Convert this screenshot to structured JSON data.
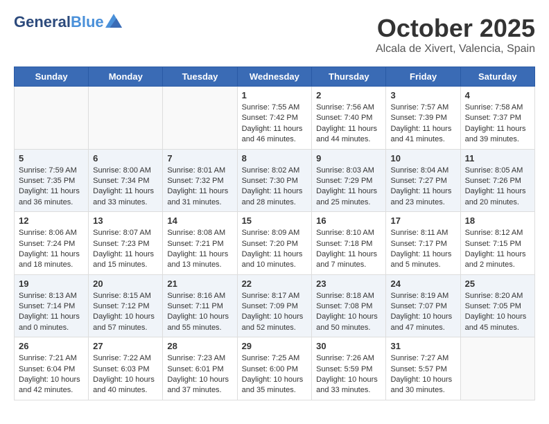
{
  "header": {
    "logo_line1": "General",
    "logo_line2": "Blue",
    "month": "October 2025",
    "location": "Alcala de Xivert, Valencia, Spain"
  },
  "days_of_week": [
    "Sunday",
    "Monday",
    "Tuesday",
    "Wednesday",
    "Thursday",
    "Friday",
    "Saturday"
  ],
  "weeks": [
    [
      {
        "day": "",
        "content": ""
      },
      {
        "day": "",
        "content": ""
      },
      {
        "day": "",
        "content": ""
      },
      {
        "day": "1",
        "content": "Sunrise: 7:55 AM\nSunset: 7:42 PM\nDaylight: 11 hours\nand 46 minutes."
      },
      {
        "day": "2",
        "content": "Sunrise: 7:56 AM\nSunset: 7:40 PM\nDaylight: 11 hours\nand 44 minutes."
      },
      {
        "day": "3",
        "content": "Sunrise: 7:57 AM\nSunset: 7:39 PM\nDaylight: 11 hours\nand 41 minutes."
      },
      {
        "day": "4",
        "content": "Sunrise: 7:58 AM\nSunset: 7:37 PM\nDaylight: 11 hours\nand 39 minutes."
      }
    ],
    [
      {
        "day": "5",
        "content": "Sunrise: 7:59 AM\nSunset: 7:35 PM\nDaylight: 11 hours\nand 36 minutes."
      },
      {
        "day": "6",
        "content": "Sunrise: 8:00 AM\nSunset: 7:34 PM\nDaylight: 11 hours\nand 33 minutes."
      },
      {
        "day": "7",
        "content": "Sunrise: 8:01 AM\nSunset: 7:32 PM\nDaylight: 11 hours\nand 31 minutes."
      },
      {
        "day": "8",
        "content": "Sunrise: 8:02 AM\nSunset: 7:30 PM\nDaylight: 11 hours\nand 28 minutes."
      },
      {
        "day": "9",
        "content": "Sunrise: 8:03 AM\nSunset: 7:29 PM\nDaylight: 11 hours\nand 25 minutes."
      },
      {
        "day": "10",
        "content": "Sunrise: 8:04 AM\nSunset: 7:27 PM\nDaylight: 11 hours\nand 23 minutes."
      },
      {
        "day": "11",
        "content": "Sunrise: 8:05 AM\nSunset: 7:26 PM\nDaylight: 11 hours\nand 20 minutes."
      }
    ],
    [
      {
        "day": "12",
        "content": "Sunrise: 8:06 AM\nSunset: 7:24 PM\nDaylight: 11 hours\nand 18 minutes."
      },
      {
        "day": "13",
        "content": "Sunrise: 8:07 AM\nSunset: 7:23 PM\nDaylight: 11 hours\nand 15 minutes."
      },
      {
        "day": "14",
        "content": "Sunrise: 8:08 AM\nSunset: 7:21 PM\nDaylight: 11 hours\nand 13 minutes."
      },
      {
        "day": "15",
        "content": "Sunrise: 8:09 AM\nSunset: 7:20 PM\nDaylight: 11 hours\nand 10 minutes."
      },
      {
        "day": "16",
        "content": "Sunrise: 8:10 AM\nSunset: 7:18 PM\nDaylight: 11 hours\nand 7 minutes."
      },
      {
        "day": "17",
        "content": "Sunrise: 8:11 AM\nSunset: 7:17 PM\nDaylight: 11 hours\nand 5 minutes."
      },
      {
        "day": "18",
        "content": "Sunrise: 8:12 AM\nSunset: 7:15 PM\nDaylight: 11 hours\nand 2 minutes."
      }
    ],
    [
      {
        "day": "19",
        "content": "Sunrise: 8:13 AM\nSunset: 7:14 PM\nDaylight: 11 hours\nand 0 minutes."
      },
      {
        "day": "20",
        "content": "Sunrise: 8:15 AM\nSunset: 7:12 PM\nDaylight: 10 hours\nand 57 minutes."
      },
      {
        "day": "21",
        "content": "Sunrise: 8:16 AM\nSunset: 7:11 PM\nDaylight: 10 hours\nand 55 minutes."
      },
      {
        "day": "22",
        "content": "Sunrise: 8:17 AM\nSunset: 7:09 PM\nDaylight: 10 hours\nand 52 minutes."
      },
      {
        "day": "23",
        "content": "Sunrise: 8:18 AM\nSunset: 7:08 PM\nDaylight: 10 hours\nand 50 minutes."
      },
      {
        "day": "24",
        "content": "Sunrise: 8:19 AM\nSunset: 7:07 PM\nDaylight: 10 hours\nand 47 minutes."
      },
      {
        "day": "25",
        "content": "Sunrise: 8:20 AM\nSunset: 7:05 PM\nDaylight: 10 hours\nand 45 minutes."
      }
    ],
    [
      {
        "day": "26",
        "content": "Sunrise: 7:21 AM\nSunset: 6:04 PM\nDaylight: 10 hours\nand 42 minutes."
      },
      {
        "day": "27",
        "content": "Sunrise: 7:22 AM\nSunset: 6:03 PM\nDaylight: 10 hours\nand 40 minutes."
      },
      {
        "day": "28",
        "content": "Sunrise: 7:23 AM\nSunset: 6:01 PM\nDaylight: 10 hours\nand 37 minutes."
      },
      {
        "day": "29",
        "content": "Sunrise: 7:25 AM\nSunset: 6:00 PM\nDaylight: 10 hours\nand 35 minutes."
      },
      {
        "day": "30",
        "content": "Sunrise: 7:26 AM\nSunset: 5:59 PM\nDaylight: 10 hours\nand 33 minutes."
      },
      {
        "day": "31",
        "content": "Sunrise: 7:27 AM\nSunset: 5:57 PM\nDaylight: 10 hours\nand 30 minutes."
      },
      {
        "day": "",
        "content": ""
      }
    ]
  ]
}
